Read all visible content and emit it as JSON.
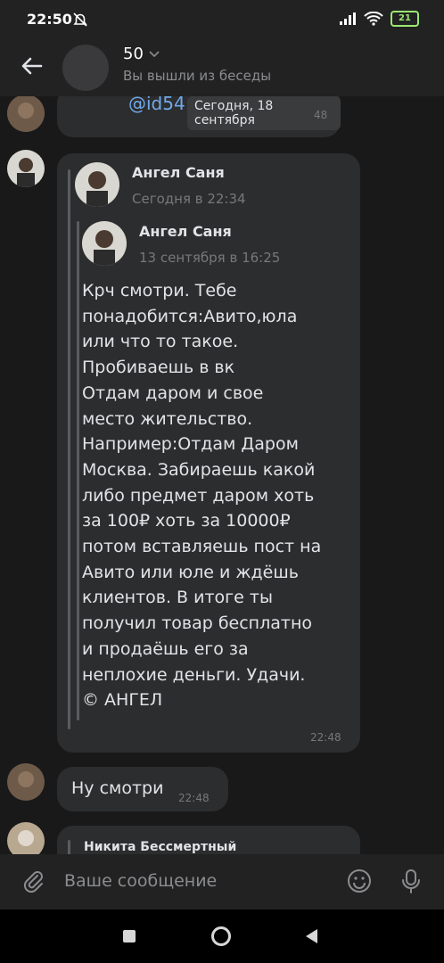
{
  "status_bar": {
    "time": "22:50",
    "battery": "21"
  },
  "header": {
    "title": "50",
    "subtitle": "Вы вышли из беседы"
  },
  "messages": {
    "top": {
      "mention": "@id54",
      "date_pill": "Сегодня, 18 сентября",
      "time": "48"
    },
    "forward": {
      "outer_name": "Ангел Саня",
      "outer_date": "Сегодня в 22:34",
      "inner_name": "Ангел Саня",
      "inner_date": "13 сентября в 16:25",
      "text": "Крч смотри. Тебе\nпонадобится:Авито,юла\nили что то такое.\nПробиваешь в вк\nОтдам даром и свое\nместо жительство.\nНапример:Отдам Даром\nМосква. Забираешь какой\nлибо предмет даром хоть\nза 100₽ хоть за 10000₽\nпотом вставляешь пост на\nАвито или юле и ждёшь\nклиентов. В итоге ты\nполучил товар бесплатно\nи продаёшь его за\nнеплохие деньги. Удачи.\n© АНГЕЛ",
      "time": "22:48"
    },
    "short": {
      "text": "Ну смотри",
      "time": "22:48"
    },
    "partial": {
      "name": "Никита Бессмертный"
    }
  },
  "input": {
    "placeholder": "Ваше сообщение"
  },
  "colors": {
    "accent": "#71aaeb",
    "bubble": "#2c2d2e",
    "background": "#19191a"
  }
}
